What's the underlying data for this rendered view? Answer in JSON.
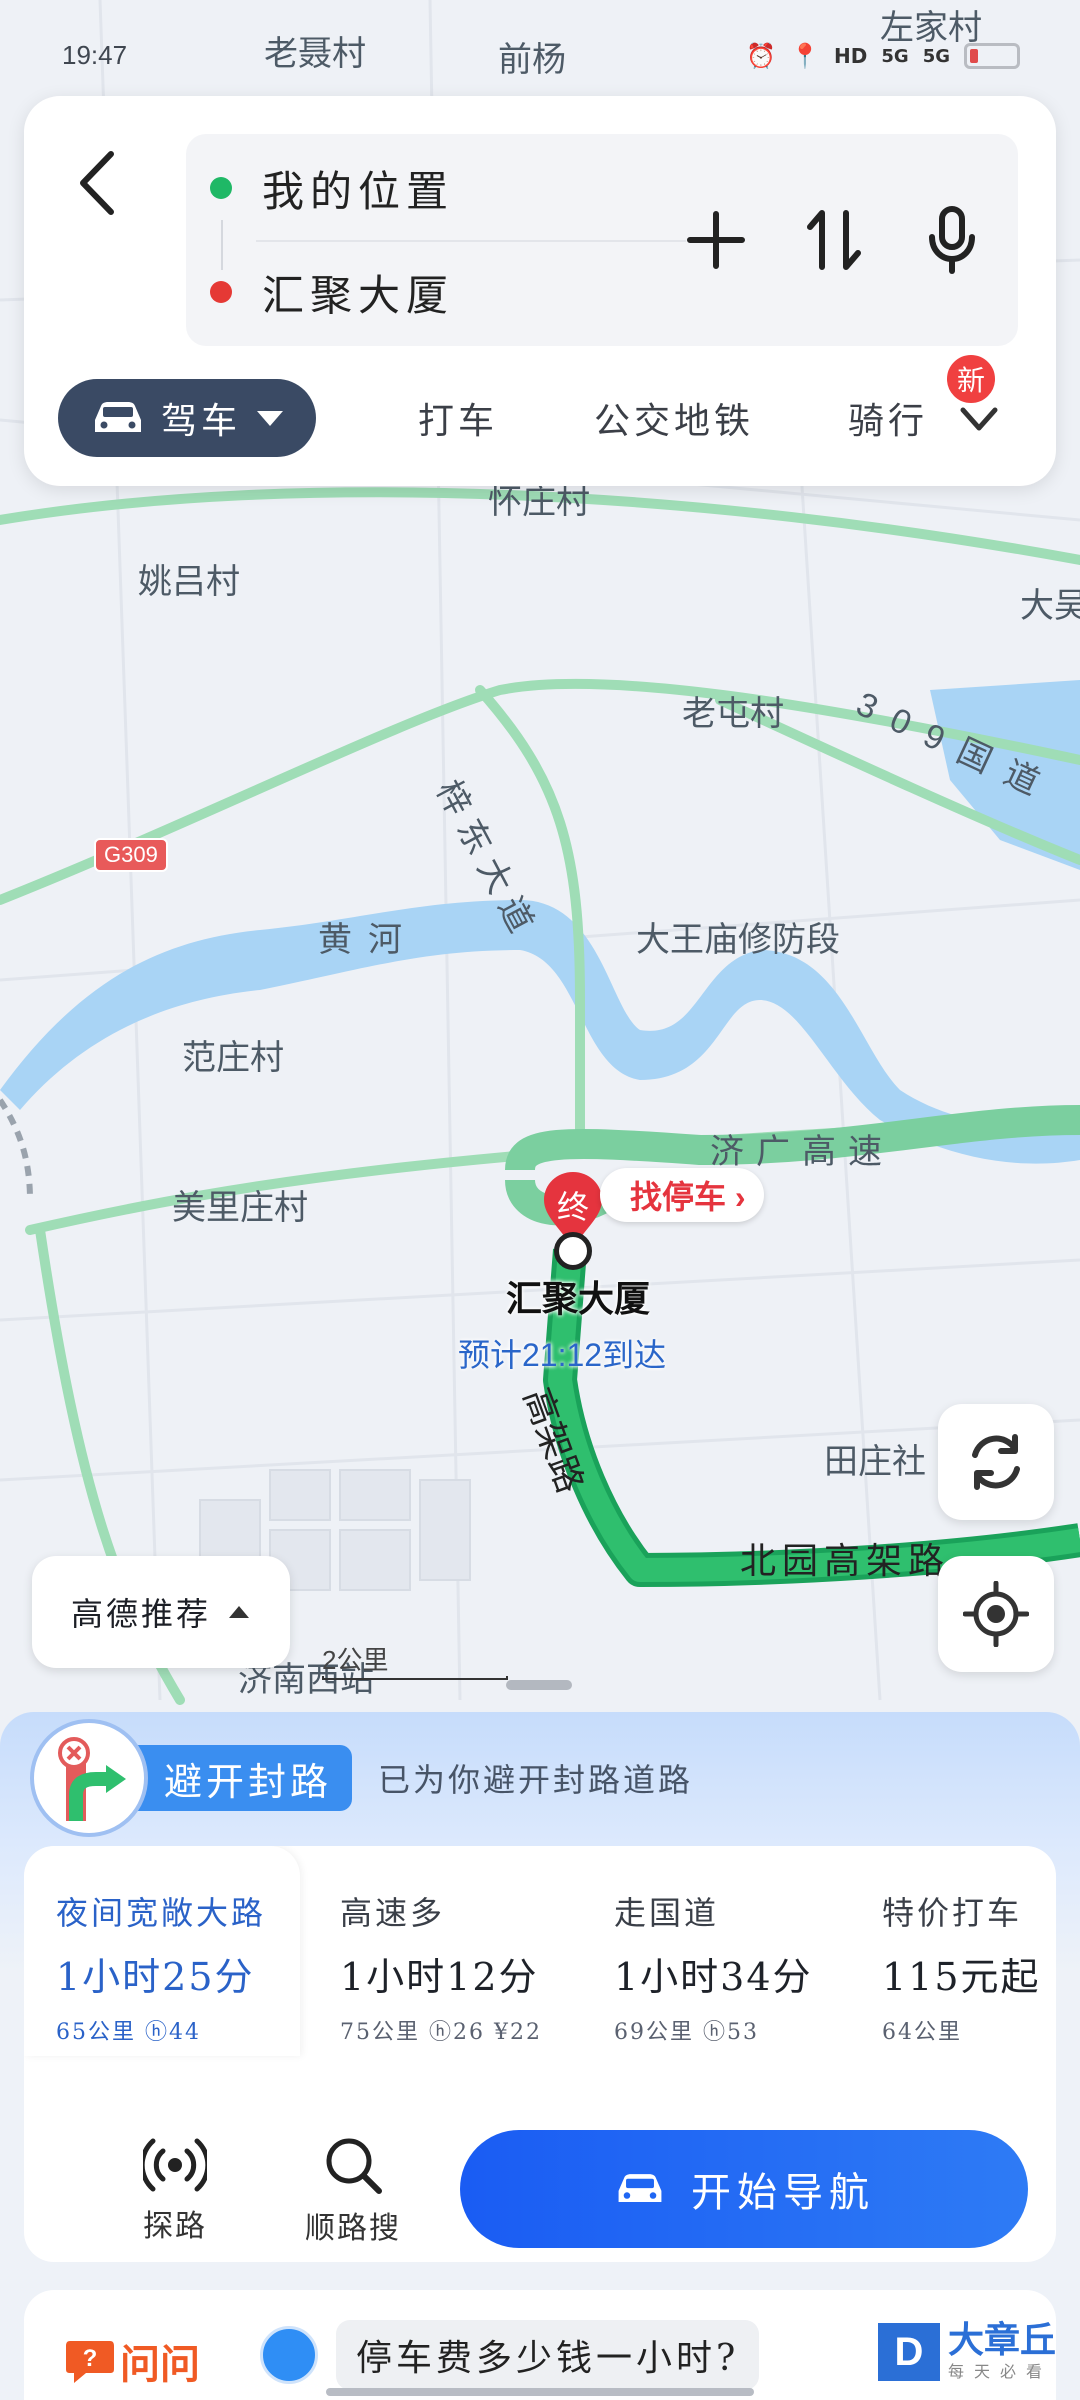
{
  "status_bar": {
    "time": "19:47",
    "network_1": "5G",
    "network_2": "5G"
  },
  "route": {
    "origin": "我的位置",
    "destination": "汇聚大厦",
    "origin_color": "#1fb866",
    "destination_color": "#e53935"
  },
  "modes": {
    "active": "驾车",
    "items": [
      "打车",
      "公交地铁",
      "骑行"
    ],
    "new_badge": "新"
  },
  "map": {
    "labels": {
      "l1": "老聂村",
      "l2": "前杨",
      "l3": "左家村",
      "l4": "姚吕村",
      "l5": "大吴",
      "l6": "老屯村",
      "l7": "309国道",
      "l8": "梓东大道",
      "l9": "黄河",
      "l10": "大王庙修防段",
      "l11": "范庄村",
      "l12": "济广高速",
      "l13": "美里庄村",
      "l14": "田庄社",
      "l15": "高架路",
      "l16": "北园高架路",
      "l17": "济南西站",
      "l18": "怀庄村"
    },
    "road_badge": "G309",
    "dest_pin_label": "终",
    "park_button": "找停车 ›",
    "dest_name": "汇聚大厦",
    "eta": "预计21:12到达",
    "recommend": "高德推荐",
    "scale": "2公里"
  },
  "avoid": {
    "title": "避开封路",
    "text": "已为你避开封路道路"
  },
  "routes": [
    {
      "name": "夜间宽敞大路",
      "time": "1小时25分",
      "meta": "65公里 ⓗ44",
      "selected": true
    },
    {
      "name": "高速多",
      "time": "1小时12分",
      "meta": "75公里 ⓗ26 ¥22",
      "selected": false
    },
    {
      "name": "走国道",
      "time": "1小时34分",
      "meta": "69公里 ⓗ53",
      "selected": false
    },
    {
      "name": "特价打车",
      "time": "115元起",
      "meta": "64公里",
      "selected": false
    }
  ],
  "actions": {
    "explore": "探路",
    "along_search": "顺路搜",
    "start_nav": "开始导航"
  },
  "ask": {
    "logo": "问问",
    "query": "停车费多少钱一小时?",
    "brand_letter": "D",
    "brand_name": "大章丘",
    "brand_sub": "每天必看"
  }
}
